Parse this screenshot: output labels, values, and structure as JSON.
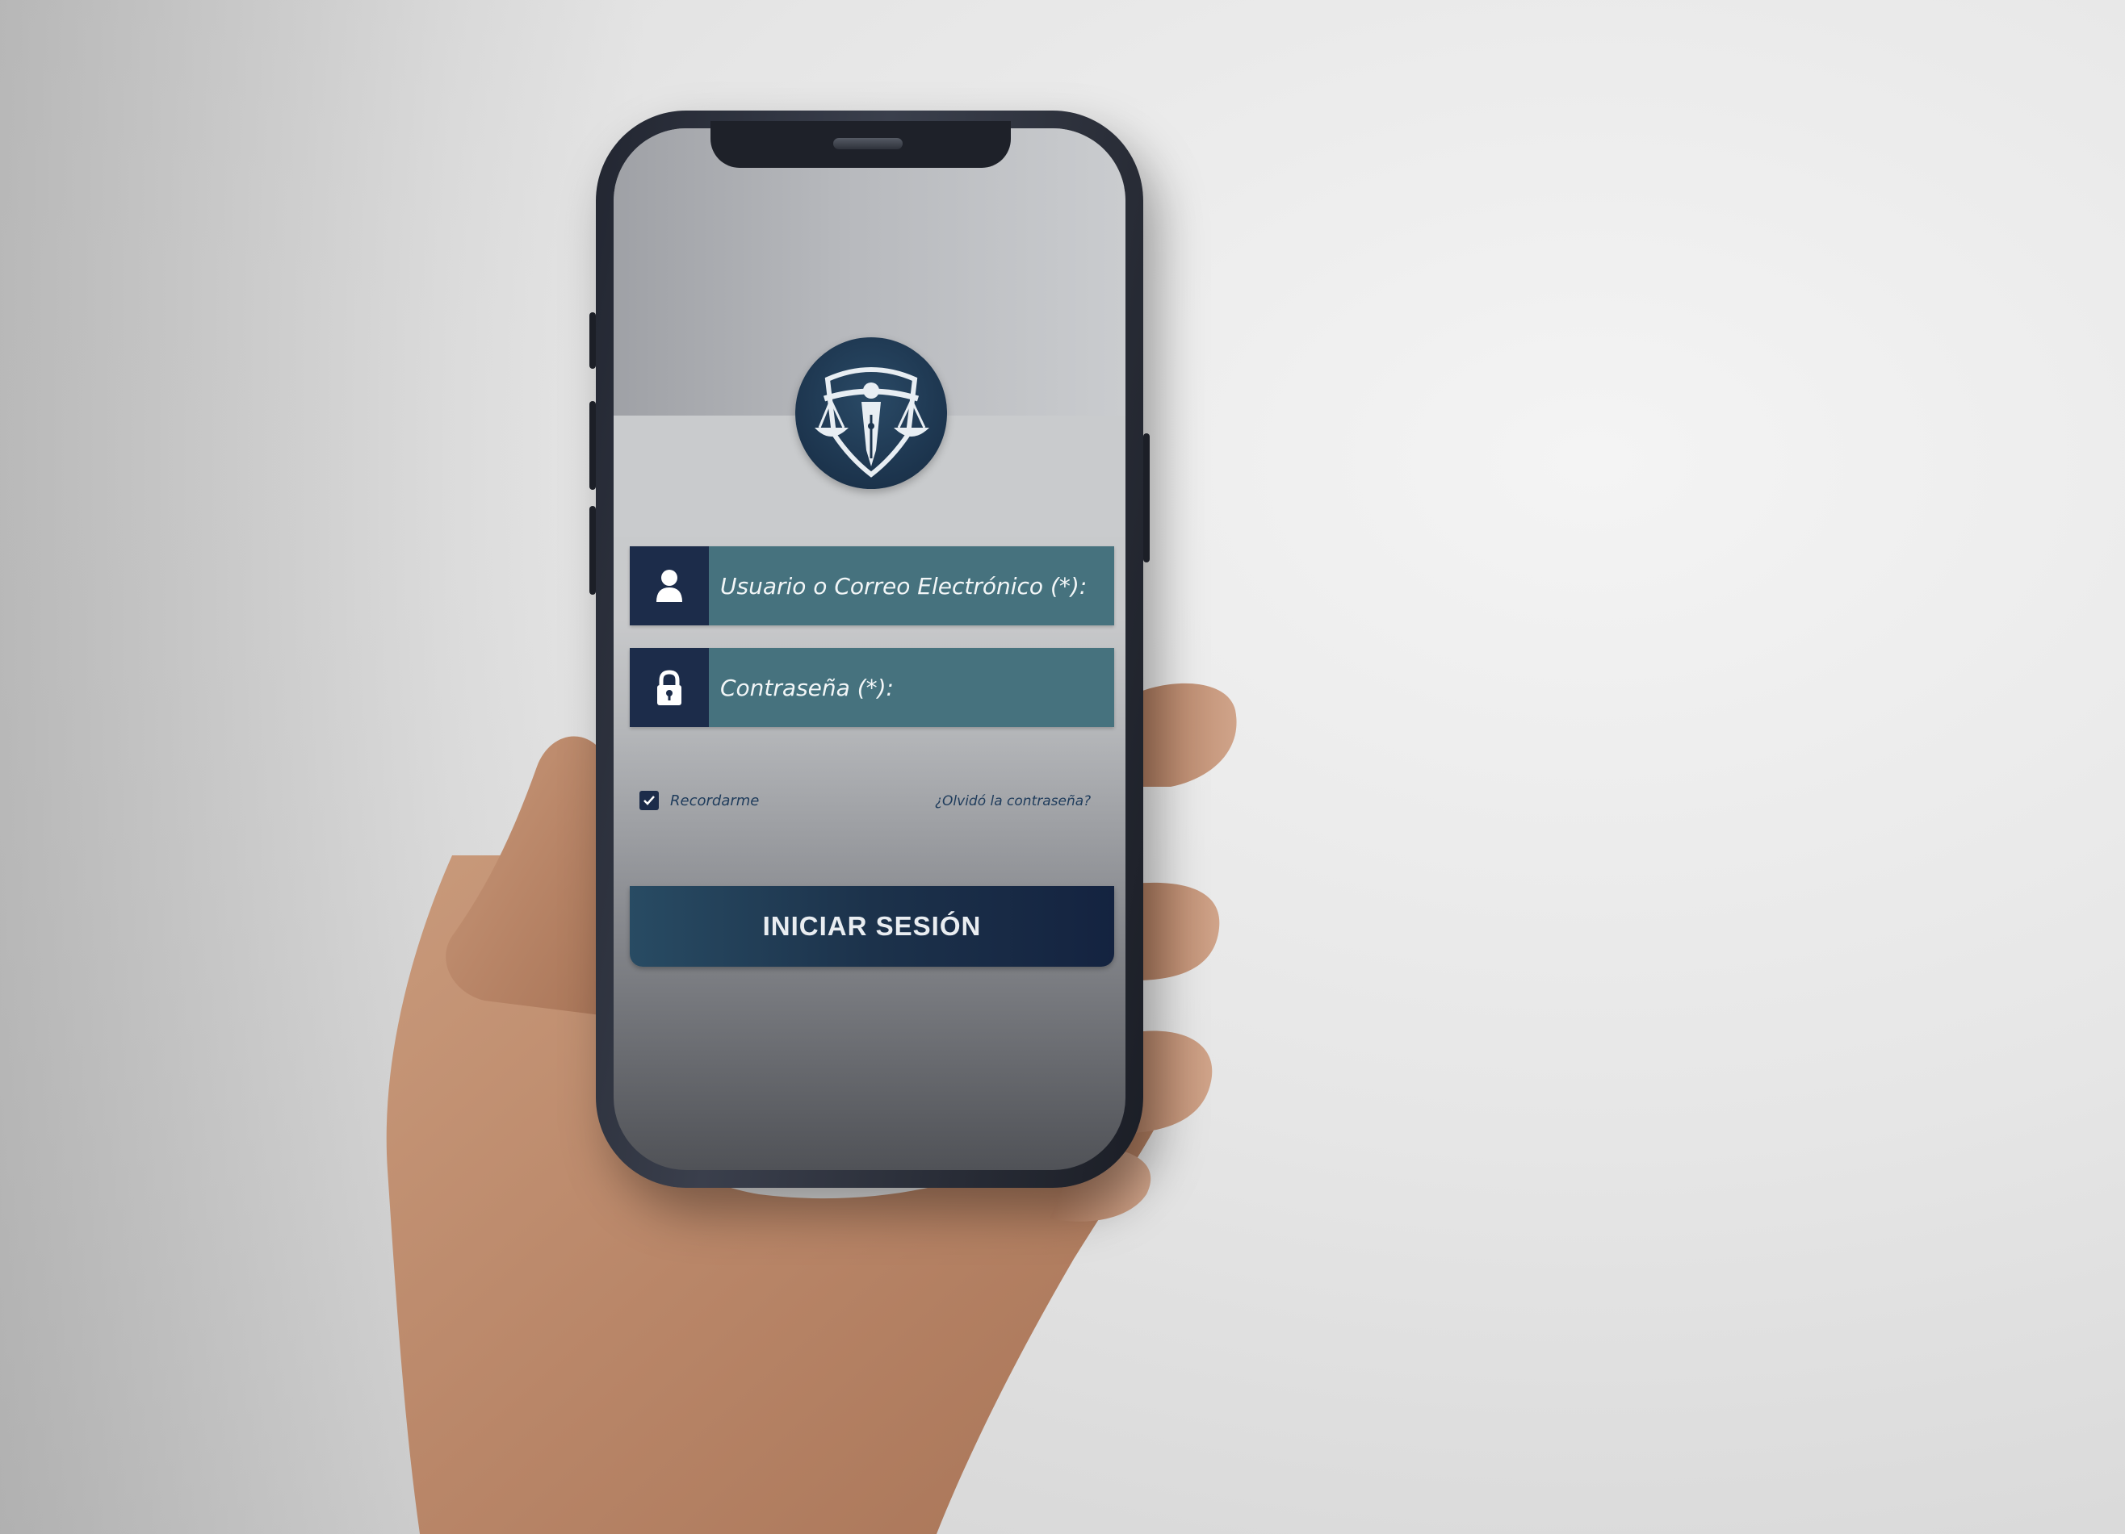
{
  "login": {
    "username_placeholder": "Usuario o Correo Electrónico (*):",
    "password_placeholder": "Contraseña (*):",
    "remember_label": "Recordarme",
    "remember_checked": true,
    "forgot_link": "¿Olvidó la contraseña?",
    "submit_label": "INICIAR SESIÓN"
  },
  "icons": {
    "logo": "scales-of-justice-pen-shield-icon",
    "username": "user-icon",
    "password": "lock-icon",
    "checkbox": "checkmark-icon"
  },
  "colors": {
    "field_background": "#46727e",
    "icon_background": "#1c2c4a",
    "button_background": "#1c324b",
    "logo_background": "#1c344d",
    "link_text": "#1f3c5c"
  }
}
